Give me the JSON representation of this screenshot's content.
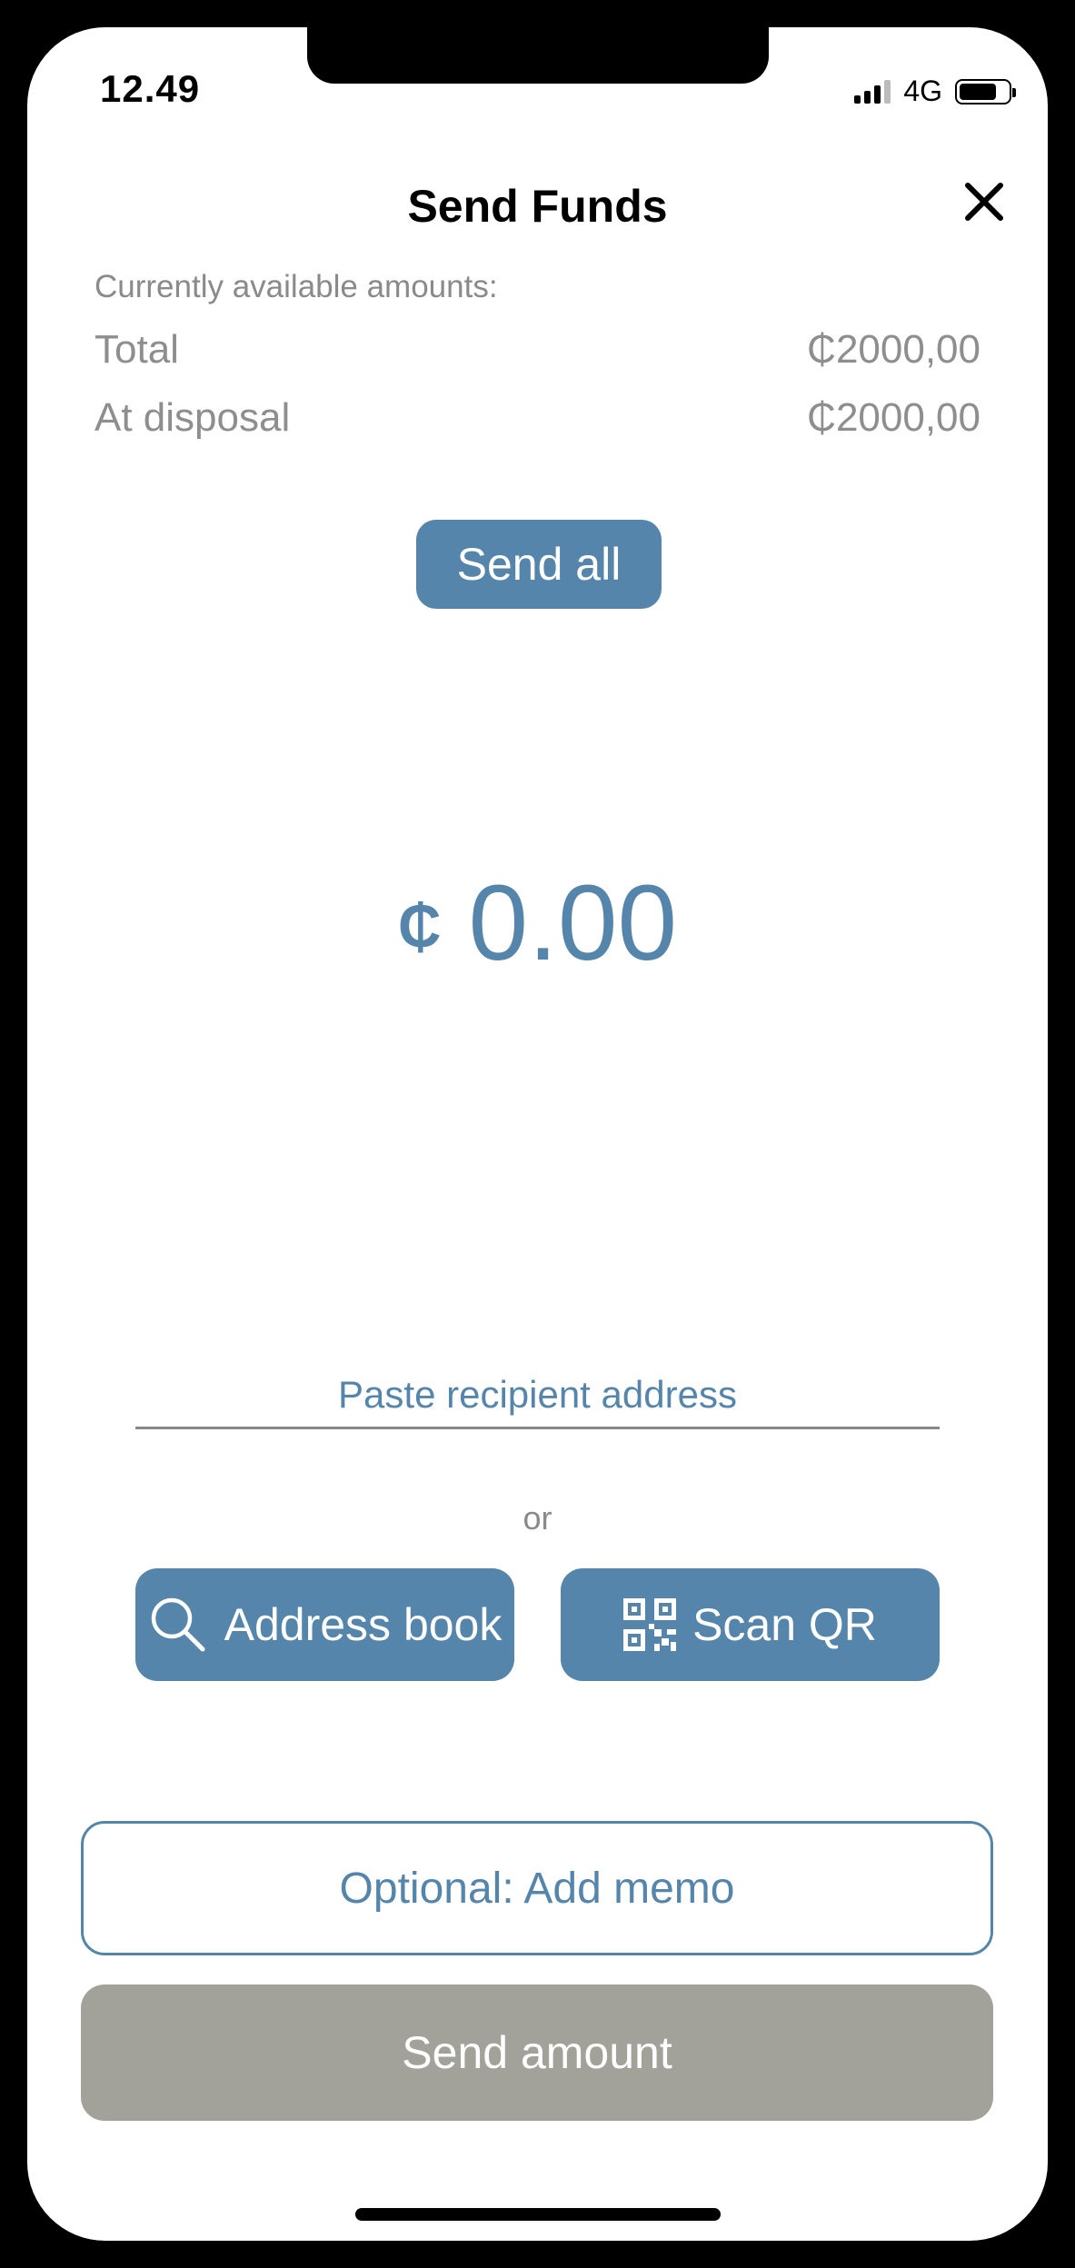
{
  "status_bar": {
    "time": "12.49",
    "network": "4G",
    "icons": [
      "signal-icon",
      "battery-icon"
    ]
  },
  "header": {
    "title": "Send Funds",
    "close_icon": "close-icon"
  },
  "balances": {
    "label": "Currently available amounts:",
    "total_label": "Total",
    "total_value": "₵2000,00",
    "disposal_label": "At disposal",
    "disposal_value": "₵2000,00"
  },
  "send_all_label": "Send all",
  "amount": {
    "currency": "₵",
    "value": "0.00"
  },
  "recipient": {
    "placeholder": "Paste recipient address",
    "value": ""
  },
  "or_text": "or",
  "buttons": {
    "address_book": "Address book",
    "address_book_icon": "search-icon",
    "scan_qr": "Scan QR",
    "scan_qr_icon": "qr-code-icon",
    "memo": "Optional: Add memo",
    "send_amount": "Send amount"
  },
  "colors": {
    "accent": "#5585ab",
    "disabled": "#a2a29b",
    "muted_text": "#8e8e8e"
  }
}
